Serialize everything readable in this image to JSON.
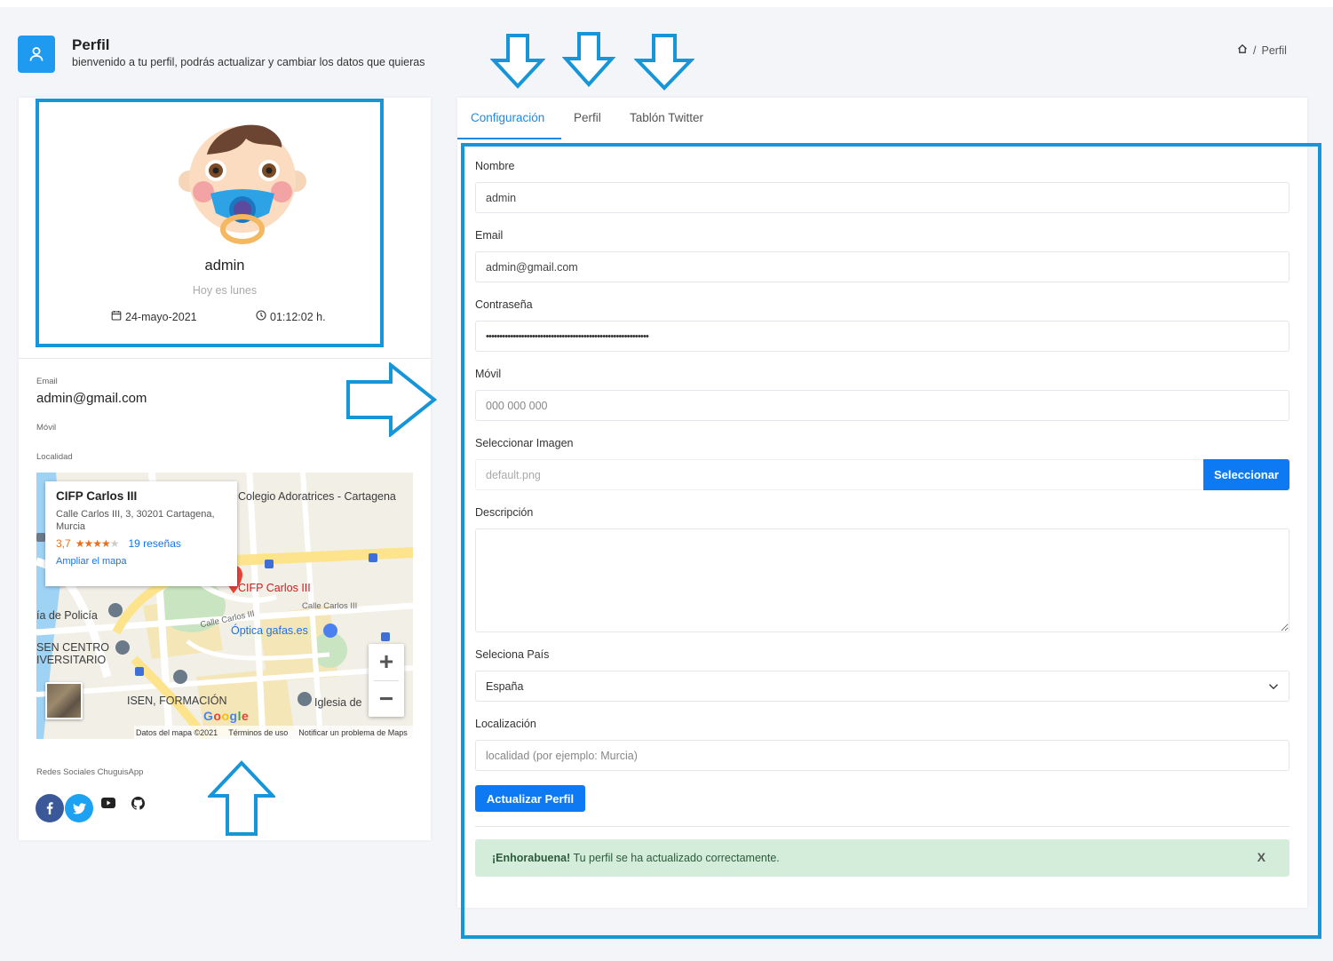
{
  "header": {
    "title": "Perfil",
    "subtitle": "bienvenido a tu perfil, podrás actualizar y cambiar los datos que quieras",
    "breadcrumb_current": "Perfil",
    "breadcrumb_sep": "/"
  },
  "profile": {
    "username": "admin",
    "today": "Hoy es lunes",
    "date": "24-mayo-2021",
    "time": "01:12:02 h.",
    "email_label": "Email",
    "email": "admin@gmail.com",
    "mobile_label": "Móvil",
    "location_label": "Localidad",
    "social_label": "Redes Sociales ChuguisApp"
  },
  "map": {
    "place_name": "CIFP Carlos III",
    "address": "Calle Carlos III, 3, 30201 Cartagena, Murcia",
    "rating": "3,7",
    "rating_stars": 3.7,
    "reviews": "19 reseñas",
    "enlarge": "Ampliar el mapa",
    "labels": {
      "colegio": "Colegio Adoratrices - Cartagena",
      "cifp": "CIFP Carlos III",
      "policia": "ía de Policía",
      "calle1": "Calle Carlos III",
      "calle2": "Calle Carlos III",
      "optica": "Óptica gafas.es",
      "centro1": "SEN CENTRO",
      "centro2": "IVERSITARIO",
      "formacion": "ISEN, FORMACIÓN",
      "iglesia": "Iglesia de",
      "google": "Google"
    },
    "footer": {
      "data": "Datos del mapa ©2021",
      "terms": "Términos de uso",
      "report": "Notificar un problema de Maps"
    },
    "zoom_in": "+",
    "zoom_out": "−"
  },
  "tabs": [
    {
      "label": "Configuración",
      "active": true
    },
    {
      "label": "Perfil",
      "active": false
    },
    {
      "label": "Tablón Twitter",
      "active": false
    }
  ],
  "form": {
    "name_label": "Nombre",
    "name_value": "admin",
    "email_label": "Email",
    "email_value": "admin@gmail.com",
    "password_label": "Contraseña",
    "password_value": "••••••••••••••••••••••••••••••••••••••••••••••••••••••••••••",
    "mobile_label": "Móvil",
    "mobile_placeholder": "000 000 000",
    "image_label": "Seleccionar Imagen",
    "image_value": "default.png",
    "image_button": "Seleccionar",
    "description_label": "Descripción",
    "country_label": "Seleciona País",
    "country_value": "España",
    "location_label": "Localización",
    "location_placeholder": "localidad (por ejemplo: Murcia)",
    "submit": "Actualizar Perfil"
  },
  "alert": {
    "strong": "¡Enhorabuena!",
    "text": " Tu perfil se ha actualizado correctamente.",
    "close": "X"
  },
  "colors": {
    "accent": "#1e88e5",
    "primary_button": "#0d79f2",
    "highlight": "#1795d9",
    "alert_bg": "#d4eddb",
    "facebook": "#3b5998",
    "twitter": "#1da1f2"
  },
  "icons": [
    "user-icon",
    "home-icon",
    "calendar-icon",
    "clock-icon",
    "facebook-icon",
    "twitter-icon",
    "youtube-icon",
    "github-icon",
    "chevron-down-icon"
  ]
}
